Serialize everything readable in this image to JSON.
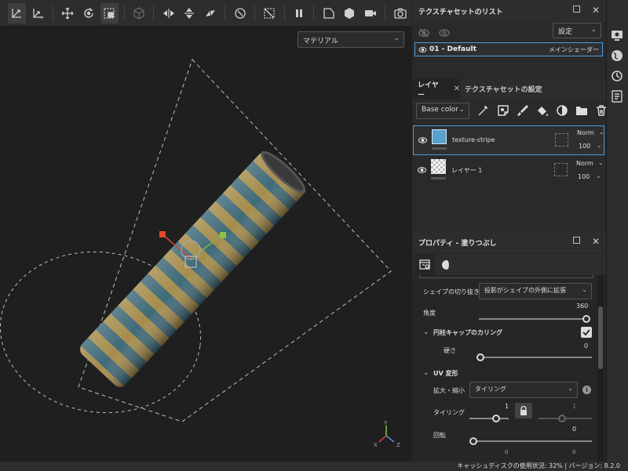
{
  "toolbar": {
    "tools": [
      "transform-2d-icon",
      "transform-uv-icon",
      "move-icon",
      "rotate-icon",
      "scale-icon",
      "object-icon",
      "flip-horizontal-icon",
      "flip-vertical-icon",
      "diagonal-flip-icon",
      "reset-icon",
      "hide-icon",
      "pause-icon",
      "projection-icon",
      "cube-icon",
      "camera-icon",
      "screenshot-icon"
    ]
  },
  "viewport": {
    "material_mode": "マテリアル",
    "axis_x": "X",
    "axis_y": "Y",
    "axis_z": "Z"
  },
  "texture_set_list": {
    "title": "テクスチャセットのリスト",
    "settings_label": "設定",
    "item_name": "01 - Default",
    "item_shader": "メインシェーダー"
  },
  "layers": {
    "tab_layers": "レイヤー",
    "tab_settings": "テクスチャセットの設定",
    "channel": "Base color",
    "items": [
      {
        "name": "texture-stripe",
        "blend": "Norm",
        "opacity": "100"
      },
      {
        "name": "レイヤー 1",
        "blend": "Norm",
        "opacity": "100"
      }
    ]
  },
  "properties": {
    "title": "プロパティ - 塗りつぶし",
    "shape_crop_label": "シェイプの切り抜き",
    "shape_crop_value": "投影がシェイプの外側に拡張",
    "angle_label": "角度",
    "angle_value": "360",
    "cylinder_cap_label": "円柱キャップのカリング",
    "hardness_label": "硬さ",
    "hardness_value": "0",
    "uv_label": "UV 変形",
    "scale_label": "拡大・縮小",
    "scale_value": "タイリング",
    "tiling_label": "タイリング",
    "tiling_value_1": "1",
    "tiling_value_2": "1",
    "tiling_bottom_value": "0",
    "rotation_label": "回転",
    "rotation_value_a": "0",
    "rotation_value_b": "0"
  },
  "status": {
    "text": "キャッシュディスクの使用状況: 32% | バージョン: 8.2.0"
  }
}
